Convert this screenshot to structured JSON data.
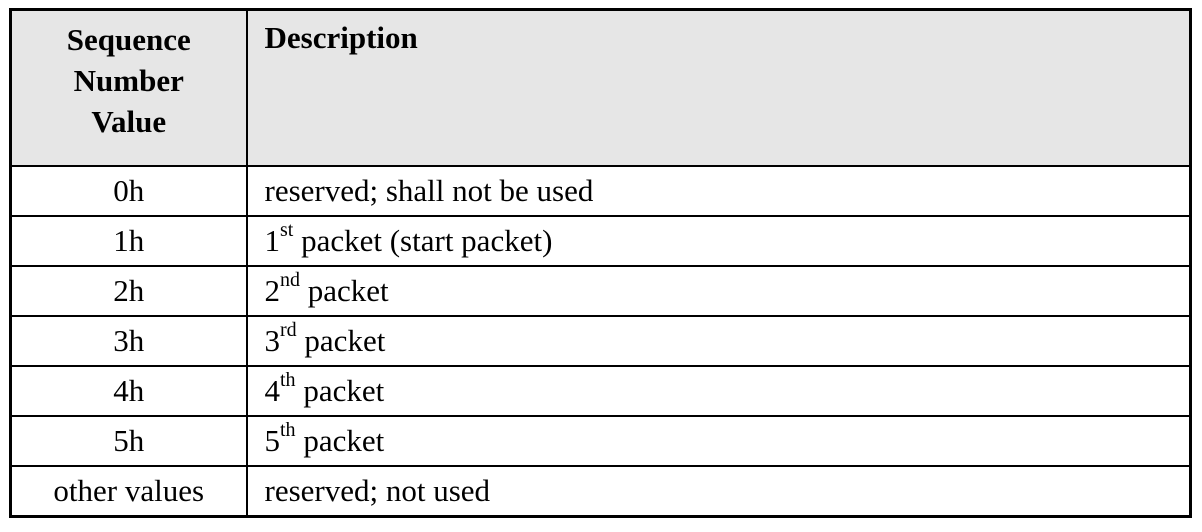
{
  "table": {
    "header": {
      "value_lines": [
        "Sequence",
        "Number",
        "Value"
      ],
      "description": "Description"
    },
    "rows": [
      {
        "value": "0h",
        "desc": "reserved; shall not be used",
        "ord": "",
        "suffix": ""
      },
      {
        "value": "1h",
        "desc": "1",
        "ord": "st",
        "suffix": " packet (start packet)"
      },
      {
        "value": "2h",
        "desc": "2",
        "ord": "nd",
        "suffix": " packet"
      },
      {
        "value": "3h",
        "desc": "3",
        "ord": "rd",
        "suffix": " packet"
      },
      {
        "value": "4h",
        "desc": "4",
        "ord": "th",
        "suffix": " packet"
      },
      {
        "value": "5h",
        "desc": "5",
        "ord": "th",
        "suffix": " packet"
      },
      {
        "value": "other values",
        "desc": "reserved; not used",
        "ord": "",
        "suffix": ""
      }
    ]
  }
}
